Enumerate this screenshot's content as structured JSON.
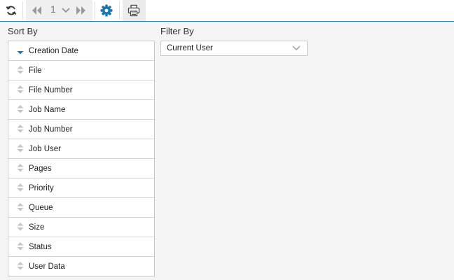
{
  "toolbar": {
    "refresh_icon": "refresh-icon",
    "first_page_icon": "double-chevron-left-icon",
    "page_number": "1",
    "page_dropdown_icon": "chevron-down-icon",
    "last_page_icon": "double-chevron-right-icon",
    "settings_icon": "gear-icon",
    "print_icon": "printer-icon",
    "accent_color": "#1a75b5",
    "divider_color": "#2a7fa8"
  },
  "sort": {
    "title": "Sort By",
    "active_index": 0,
    "active_color": "#1a75b5",
    "items": [
      {
        "label": "Creation Date"
      },
      {
        "label": "File"
      },
      {
        "label": "File Number"
      },
      {
        "label": "Job Name"
      },
      {
        "label": "Job Number"
      },
      {
        "label": "Job User"
      },
      {
        "label": "Pages"
      },
      {
        "label": "Priority"
      },
      {
        "label": "Queue"
      },
      {
        "label": "Size"
      },
      {
        "label": "Status"
      },
      {
        "label": "User Data"
      }
    ]
  },
  "filter": {
    "title": "Filter By",
    "selected": "Current User"
  }
}
